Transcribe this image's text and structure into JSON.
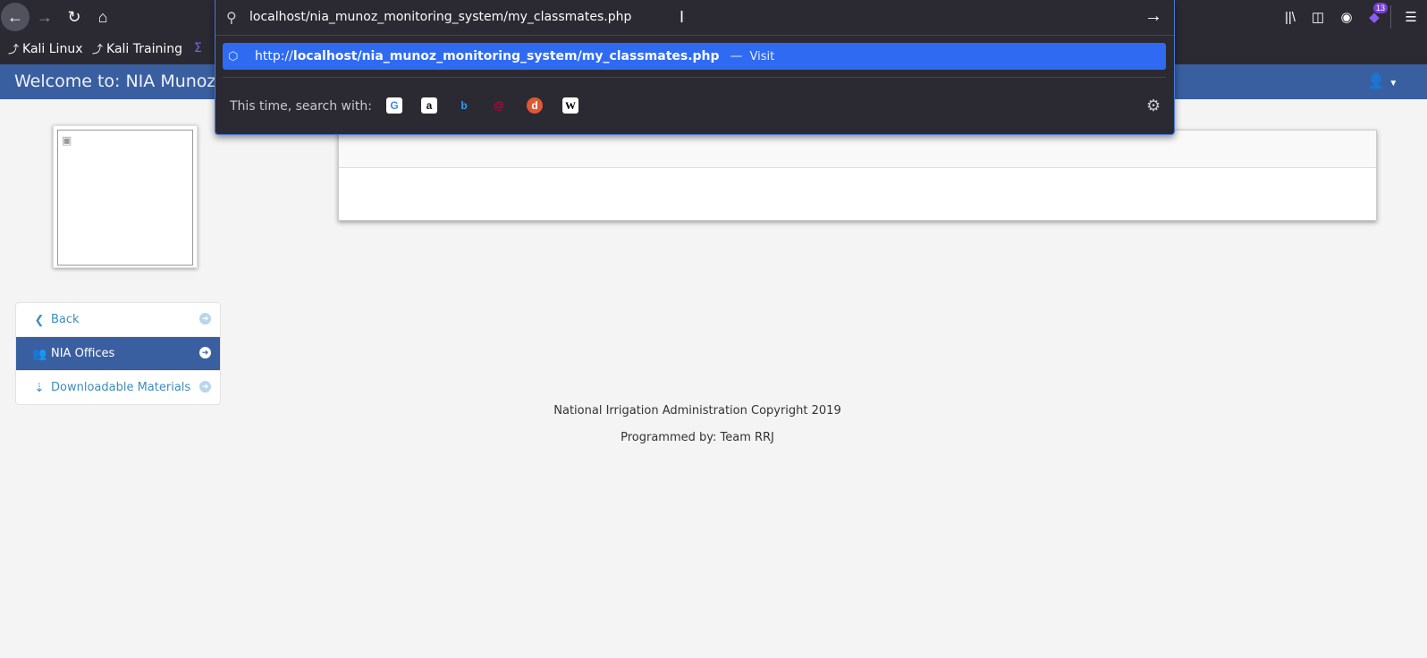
{
  "browser": {
    "url": "localhost/nia_munoz_monitoring_system/my_classmates.php",
    "suggestion": {
      "prefix": "http://",
      "host_path": "localhost/nia_munoz_monitoring_system/my_classmates.php",
      "dash": "—",
      "action": "Visit"
    },
    "search_with_label": "This time, search with:",
    "engines": [
      "google",
      "amazon",
      "bing",
      "debian",
      "duckduckgo",
      "wikipedia"
    ],
    "extension_badge": "13",
    "bookmarks": [
      "Kali Linux",
      "Kali Training"
    ]
  },
  "header": {
    "welcome": "Welcome to: NIA Munoz, N"
  },
  "sidebar": {
    "items": [
      {
        "label": "Back",
        "icon": "chevron-left-icon",
        "active": false
      },
      {
        "label": "NIA Offices",
        "icon": "users-icon",
        "active": true
      },
      {
        "label": "Downloadable Materials",
        "icon": "download-icon",
        "active": false
      }
    ]
  },
  "footer": {
    "copyright": "National Irrigation Administration Copyright 2019",
    "credit": "Programmed by: Team RRJ"
  },
  "colors": {
    "header_bg": "#3a5fa0",
    "link": "#3c8dbc",
    "suggest_highlight": "#2e6bf2",
    "chrome_bg": "#2b2a33"
  }
}
